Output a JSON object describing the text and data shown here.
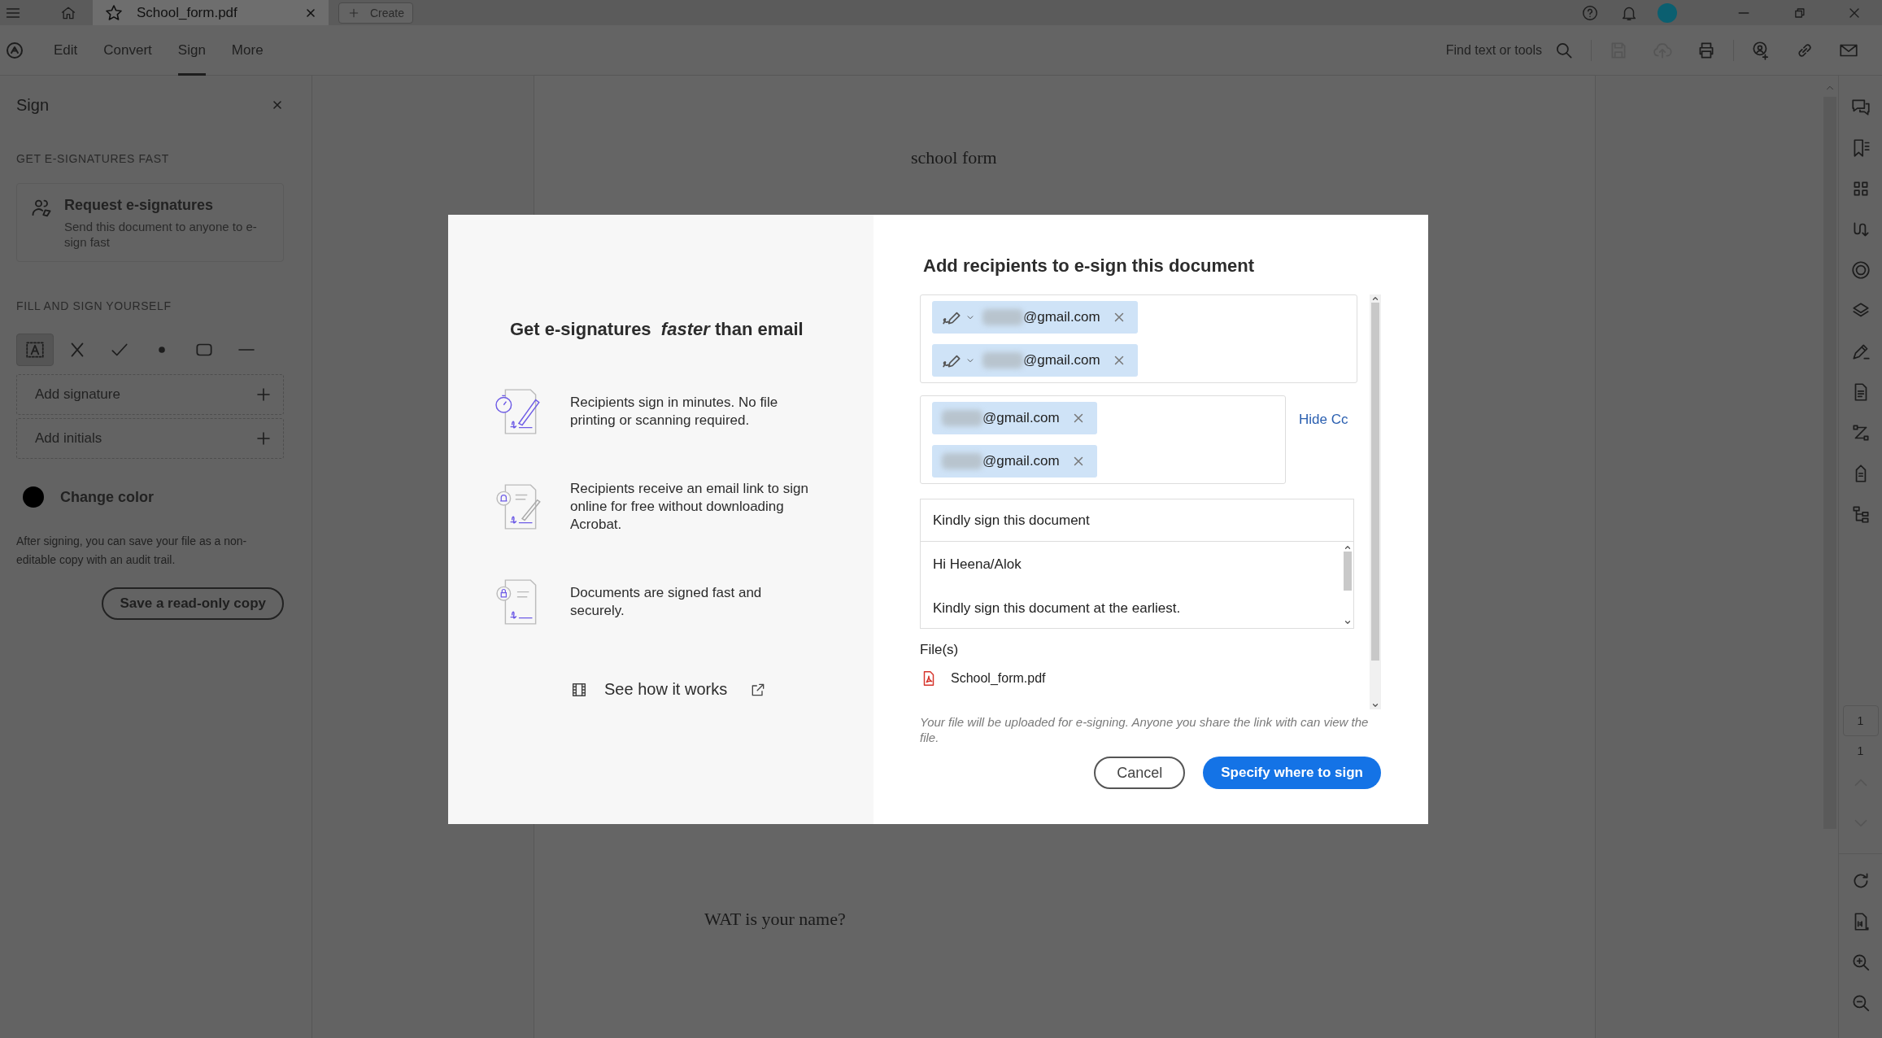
{
  "title_bar": {
    "tabs": [
      {
        "label": "School_form.pdf",
        "selected": true
      }
    ],
    "create_label": "Create"
  },
  "toolbar": {
    "menu": [
      {
        "label": "Edit",
        "selected": false
      },
      {
        "label": "Convert",
        "selected": false
      },
      {
        "label": "Sign",
        "selected": true
      },
      {
        "label": "More",
        "selected": false
      }
    ],
    "search_label": "Find text or tools"
  },
  "sign_panel": {
    "title": "Sign",
    "request_heading": "GET E-SIGNATURES FAST",
    "request_card": {
      "title": "Request e-signatures",
      "description": "Send this document to anyone to e-sign fast"
    },
    "fill_heading": "FILL AND SIGN YOURSELF",
    "tools": [
      {
        "kind": "text",
        "selected": true
      },
      {
        "kind": "cross",
        "selected": false
      },
      {
        "kind": "check",
        "selected": false
      },
      {
        "kind": "dot",
        "selected": false
      },
      {
        "kind": "rect",
        "selected": false
      },
      {
        "kind": "line",
        "selected": false
      }
    ],
    "add_rows": [
      "Add signature",
      "Add initials"
    ],
    "color_label": "Change color",
    "color": "#000000",
    "note": "After signing, you can save your file as a non-editable copy with an audit trail.",
    "save_button": "Save a read-only copy"
  },
  "document": {
    "lines": [
      "school form",
      "WAT is your name?"
    ]
  },
  "page_nav": {
    "current": "1",
    "total": "1"
  },
  "dialog": {
    "promo": {
      "heading": "Get e-signatures  *faster* than email",
      "features": [
        {
          "kind": "timer",
          "text": "Recipients sign in minutes. No file printing or scanning required."
        },
        {
          "kind": "bell",
          "text": "Recipients receive an email link to sign online for free without downloading Acrobat."
        },
        {
          "kind": "lock",
          "text": "Documents are signed fast and securely."
        }
      ],
      "video_link": "See how it works"
    },
    "form": {
      "title": "Add recipients to e-sign this document",
      "signers": [
        {
          "email": "@gmail.com"
        },
        {
          "email": "@gmail.com"
        }
      ],
      "cc": [
        {
          "email": "@gmail.com"
        },
        {
          "email": "@gmail.com"
        }
      ],
      "hide_cc": "Hide Cc",
      "subject": "Kindly sign this document",
      "message": "Hi Heena/Alok\n\nKindly sign this document at the earliest.",
      "files_label": "File(s)",
      "files": [
        "School_form.pdf"
      ],
      "note": "Your file will be uploaded for e-signing. Anyone you share the link with can view the file.",
      "cancel": "Cancel",
      "submit": "Specify where to sign"
    }
  }
}
